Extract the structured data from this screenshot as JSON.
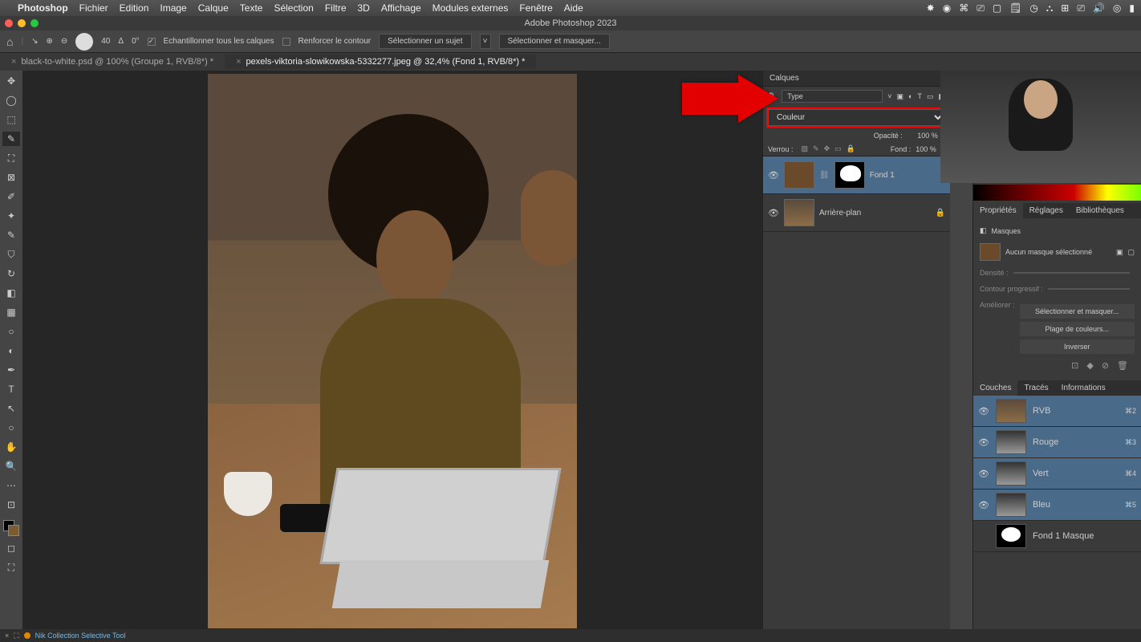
{
  "mac_menu": {
    "app": "Photoshop",
    "items": [
      "Fichier",
      "Edition",
      "Image",
      "Calque",
      "Texte",
      "Sélection",
      "Filtre",
      "3D",
      "Affichage",
      "Modules externes",
      "Fenêtre",
      "Aide"
    ]
  },
  "window_title": "Adobe Photoshop 2023",
  "options_bar": {
    "brush_size": "40",
    "angle_label": "Δ",
    "angle_value": "0°",
    "sample_all": "Echantillonner tous les calques",
    "reinforce": "Renforcer le contour",
    "select_subject": "Sélectionner un sujet",
    "select_mask": "Sélectionner et masquer..."
  },
  "tabs": [
    {
      "label": "black-to-white.psd @ 100% (Groupe 1, RVB/8*) *",
      "active": false
    },
    {
      "label": "pexels-viktoria-slowikowska-5332277.jpeg @ 32,4% (Fond 1, RVB/8*) *",
      "active": true
    }
  ],
  "layers_panel": {
    "title": "Calques",
    "filter_label": "Type",
    "blend_mode": "Couleur",
    "opacity_label": "Opacité :",
    "opacity_value": "100 %",
    "lock_label": "Verrou :",
    "fill_label": "Fond :",
    "fill_value": "100 %",
    "layers": [
      {
        "name": "Fond 1",
        "has_mask": true,
        "selected": true
      },
      {
        "name": "Arrière-plan",
        "locked": true
      }
    ]
  },
  "properties": {
    "tabs": [
      "Propriétés",
      "Réglages",
      "Bibliothèques"
    ],
    "masks_label": "Masques",
    "no_mask": "Aucun masque sélectionné",
    "density": "Densité :",
    "feather": "Contour progressif :",
    "refine": "Améliorer :",
    "btn_select_mask": "Sélectionner et masquer...",
    "btn_color_range": "Plage de couleurs...",
    "btn_invert": "Inverser"
  },
  "channels": {
    "tabs": [
      "Couches",
      "Tracés",
      "Informations"
    ],
    "items": [
      {
        "name": "RVB",
        "shortcut": "⌘2",
        "color": true
      },
      {
        "name": "Rouge",
        "shortcut": "⌘3"
      },
      {
        "name": "Vert",
        "shortcut": "⌘4"
      },
      {
        "name": "Bleu",
        "shortcut": "⌘5"
      },
      {
        "name": "Fond 1 Masque",
        "shortcut": "",
        "mask": true
      }
    ]
  },
  "status": {
    "nik": "Nik Collection Selective Tool"
  }
}
